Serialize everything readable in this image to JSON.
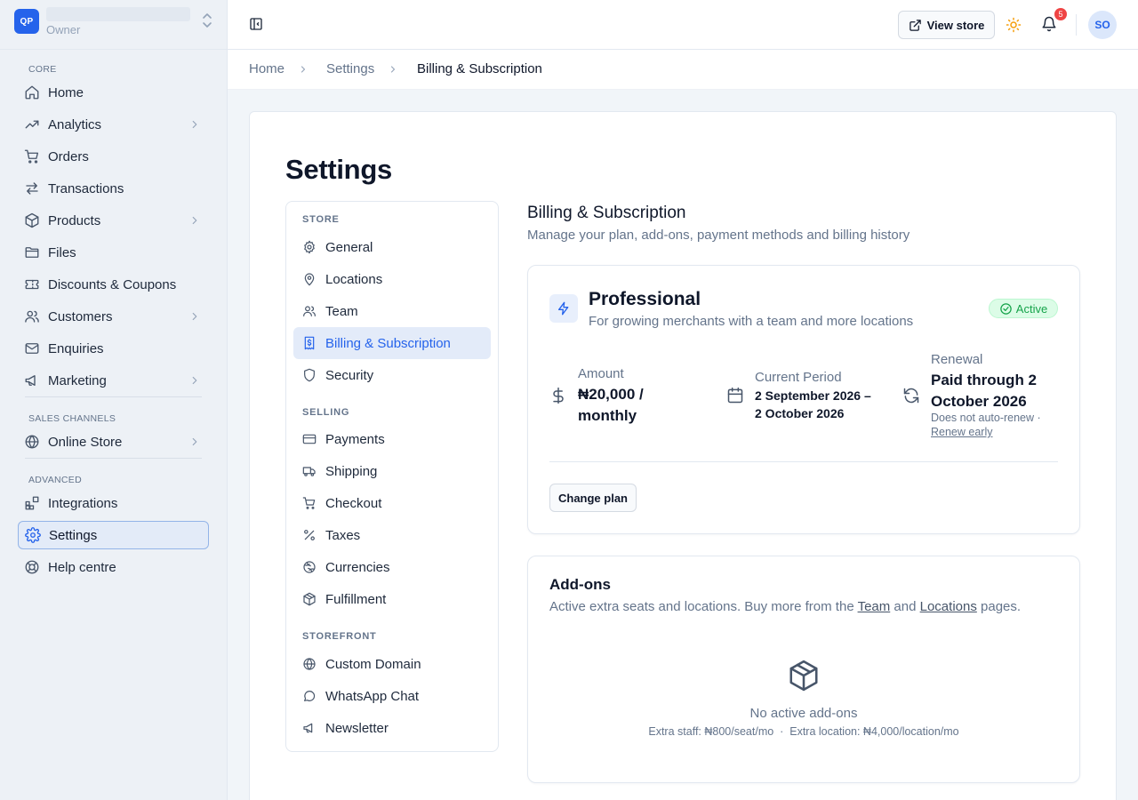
{
  "sidebar": {
    "store": {
      "logo_text": "QP",
      "role": "Owner"
    },
    "groups": {
      "core": "CORE",
      "sales": "SALES CHANNELS",
      "advanced": "ADVANCED"
    },
    "items": {
      "home": "Home",
      "analytics": "Analytics",
      "orders": "Orders",
      "transactions": "Transactions",
      "products": "Products",
      "files": "Files",
      "discounts": "Discounts & Coupons",
      "customers": "Customers",
      "enquiries": "Enquiries",
      "marketing": "Marketing",
      "online_store": "Online Store",
      "integrations": "Integrations",
      "settings": "Settings",
      "help": "Help centre"
    },
    "active_item": "Settings"
  },
  "topbar": {
    "view_store_label": "View store",
    "notification_count": "5",
    "avatar_initials": "SO",
    "theme_icon": "sun-icon"
  },
  "breadcrumb": [
    "Home",
    "Settings",
    "Billing & Subscription"
  ],
  "page": {
    "title": "Settings"
  },
  "settings_nav": {
    "sections": {
      "store": "STORE",
      "selling": "SELLING",
      "storefront": "STOREFRONT"
    },
    "items": {
      "general": "General",
      "locations": "Locations",
      "team": "Team",
      "billing": "Billing & Subscription",
      "security": "Security",
      "payments": "Payments",
      "shipping": "Shipping",
      "checkout": "Checkout",
      "taxes": "Taxes",
      "currencies": "Currencies",
      "fulfillment": "Fulfillment",
      "custom_domain": "Custom Domain",
      "whatsapp": "WhatsApp Chat",
      "newsletter": "Newsletter"
    },
    "active_item": "Billing & Subscription"
  },
  "billing": {
    "title": "Billing & Subscription",
    "subtitle": "Manage your plan, add-ons, payment methods and billing history",
    "plan": {
      "name": "Professional",
      "description": "For growing merchants with a team and more locations",
      "status": "Active",
      "amount_label": "Amount",
      "amount_line1": "₦20,000 /",
      "amount_line2": "monthly",
      "period_label": "Current Period",
      "period_line1": "2 September 2026 –",
      "period_line2": "2 October 2026",
      "renewal_label": "Renewal",
      "renewal_line1": "Paid through 2",
      "renewal_line2": "October 2026",
      "renewal_note": "Does not auto-renew ·",
      "renew_link": "Renew early",
      "change_plan_label": "Change plan"
    },
    "addons": {
      "title": "Add-ons",
      "subtitle_prefix": "Active extra seats and locations. Buy more from the ",
      "team_link": "Team",
      "subtitle_mid": " and ",
      "locations_link": "Locations",
      "subtitle_suffix": " pages.",
      "empty_title": "No active add-ons",
      "pricing": "Extra staff: ₦800/seat/mo  ·  Extra location: ₦4,000/location/mo"
    }
  },
  "colors": {
    "accent": "#2563eb",
    "status_active": "#16a34a",
    "badge": "#ef4444",
    "theme_icon": "#f59e0b"
  }
}
